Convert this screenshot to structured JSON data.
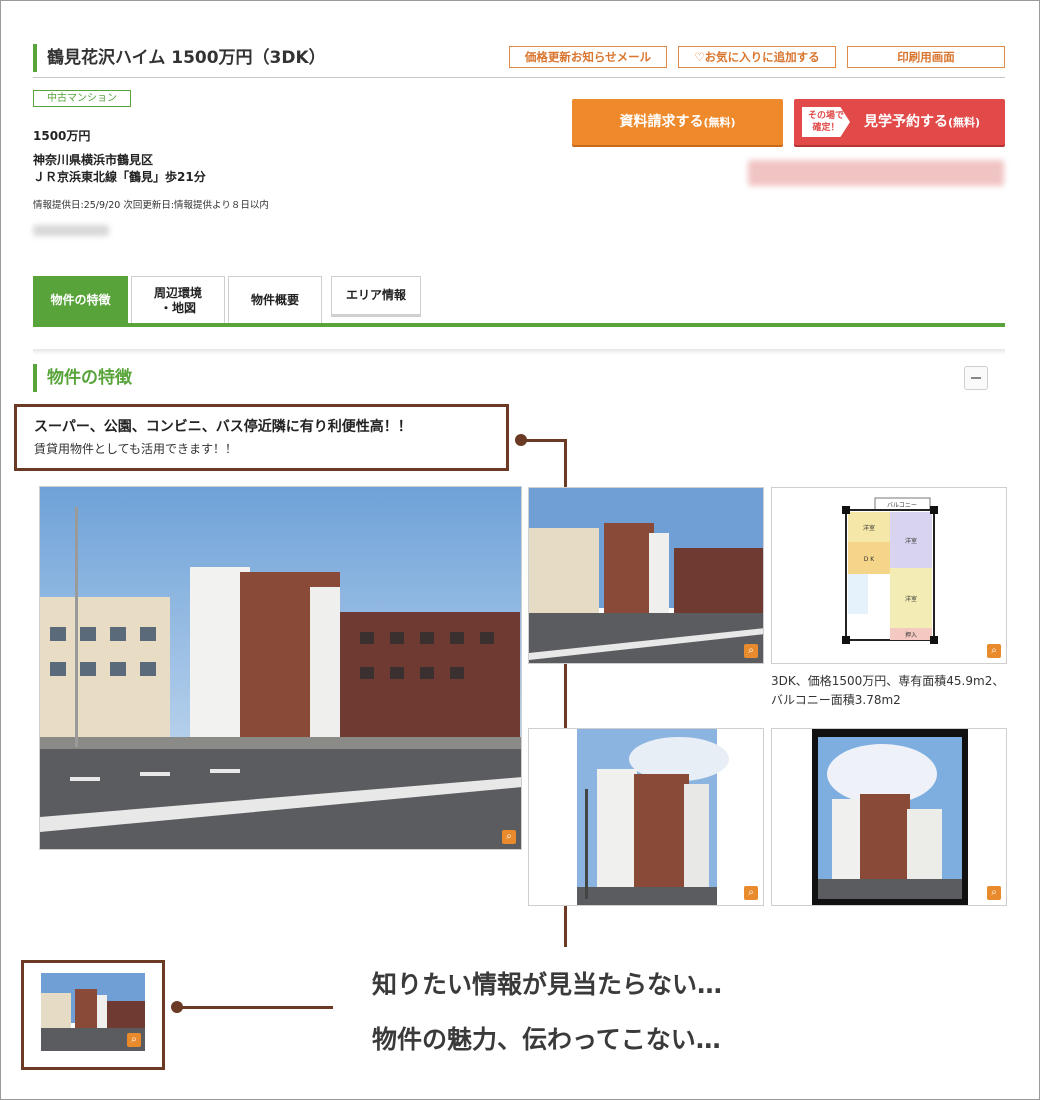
{
  "header": {
    "title": "鶴見花沢ハイム 1500万円（3DK）",
    "btn_price_mail": "価格更新お知らせメール",
    "btn_favorite": "♡お気に入りに追加する",
    "btn_print": "印刷用画面"
  },
  "property": {
    "type_badge": "中古マンション",
    "price": "1500万円",
    "address": "神奈川県横浜市鶴見区",
    "access": "ＪＲ京浜東北線「鶴見」歩21分",
    "info_dates": "情報提供日:25/9/20  次回更新日:情報提供より８日以内"
  },
  "actions": {
    "request_label": "資料請求する",
    "request_note": "(無料)",
    "visit_tag_1": "その場で",
    "visit_tag_2": "確定！",
    "visit_label": "見学予約する",
    "visit_note": "(無料)"
  },
  "tabs": [
    {
      "label": "物件の特徴"
    },
    {
      "label": "周辺環境\n・地図"
    },
    {
      "label": "物件概要"
    },
    {
      "label": "エリア情報"
    }
  ],
  "section": {
    "title": "物件の特徴",
    "catch_line1": "スーパー、公園、コンビニ、バス停近隣に有り利便性高！！",
    "catch_line2": "賃貸用物件としても活用できます！！"
  },
  "floorplan": {
    "balcony": "バルコニー",
    "room1": "洋室",
    "room2": "洋室",
    "room3": "洋室",
    "dk": "D  K",
    "storage": "押入",
    "caption": "3DK、価格1500万円、専有面積45.9m2、バルコニー面積3.78m2"
  },
  "callout": {
    "line1": "知りたい情報が見当たらない…",
    "line2": "物件の魅力、伝わってこない…"
  },
  "icons": {
    "zoom": "zoom-icon",
    "collapse": "minus-icon"
  },
  "colors": {
    "accent_green": "#58a43a",
    "orange": "#ef8a2c",
    "red": "#e24a4a",
    "annotation_brown": "#6b3a24"
  }
}
